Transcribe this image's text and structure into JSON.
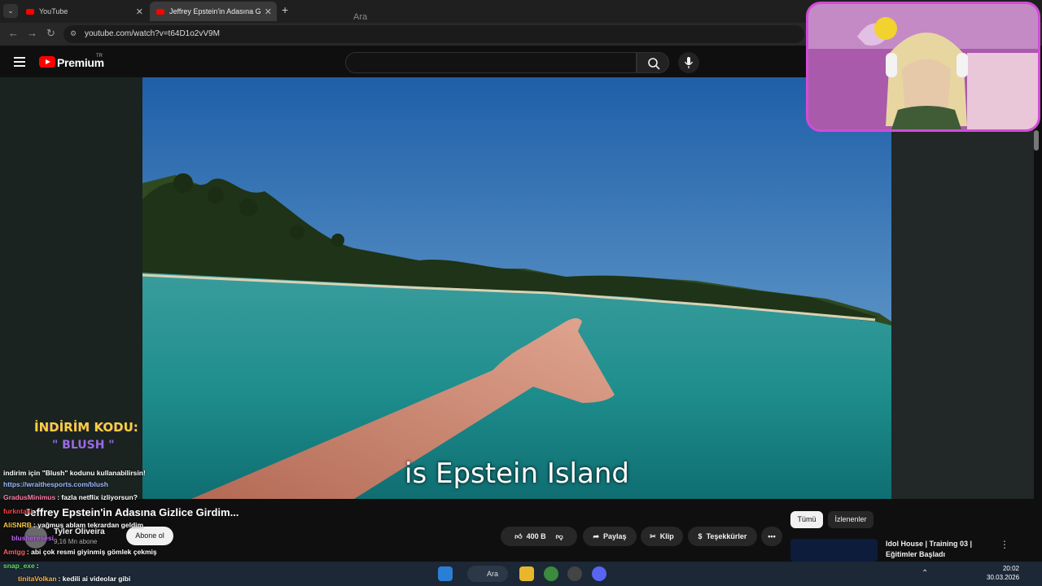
{
  "browser": {
    "tabs": [
      {
        "title": "YouTube"
      },
      {
        "title": "Jeffrey Epstein'in Adasına G"
      }
    ],
    "url": "youtube.com/watch?v=t64D1o2vV9M"
  },
  "header": {
    "brand": "Premium",
    "country": "TR",
    "search_placeholder": "Ara"
  },
  "video": {
    "caption": "is Epstein Island",
    "title": "Jeffrey Epstein'in Adasına Gizlice Girdim...",
    "channel": "Tyler Oliveira",
    "subscribers": "9,16 Mn abone",
    "subscribe_label": "Abone ol",
    "likes": "400 B",
    "share_label": "Paylaş",
    "clip_label": "Klip",
    "thanks_label": "Teşekkürler"
  },
  "sidebar": {
    "chips": [
      "Tümü",
      "İzlenenler"
    ],
    "recommended_title": "Idol House | Training 03 | Eğitimler Başladı"
  },
  "stream_overlay": {
    "promo_title": "İNDİRİM KODU:",
    "promo_code": "\" BLUSH \"",
    "chat": [
      {
        "user": "",
        "text": "indirim için \"Blush\" kodunu kullanabilirsin!",
        "color": "#ffffff"
      },
      {
        "user": "",
        "text": "https://wraithesports.com/blush",
        "color": "#9fb7ff"
      },
      {
        "user": "GradusMinimus",
        "text": ": fazla netflix izliyorsun?",
        "color": "#ff7aa8"
      },
      {
        "user": "furkntaki",
        "text": "",
        "color": "#ff4040"
      },
      {
        "user": "AliSNRB",
        "text": ": yağmuş ablam tekrardan geldim",
        "color": "#f5c542"
      },
      {
        "user": "blusheresesi",
        "text": "",
        "color": "#c060ff"
      },
      {
        "user": "Amtgg",
        "text": ": abi çok resmi giyinmiş gömlek çekmiş",
        "color": "#ff5f5f"
      },
      {
        "user": "snap_exe",
        "text": ":",
        "color": "#60e060"
      },
      {
        "user": "tinitaVolkan",
        "text": ": kedili ai videolar gibi",
        "color": "#ffb347"
      }
    ]
  },
  "taskbar": {
    "search_label": "Ara",
    "time": "20:02",
    "date": "30.03.2026"
  },
  "colors": {
    "youtube_red": "#ff0000",
    "webcam_border": "#d24bd8"
  }
}
